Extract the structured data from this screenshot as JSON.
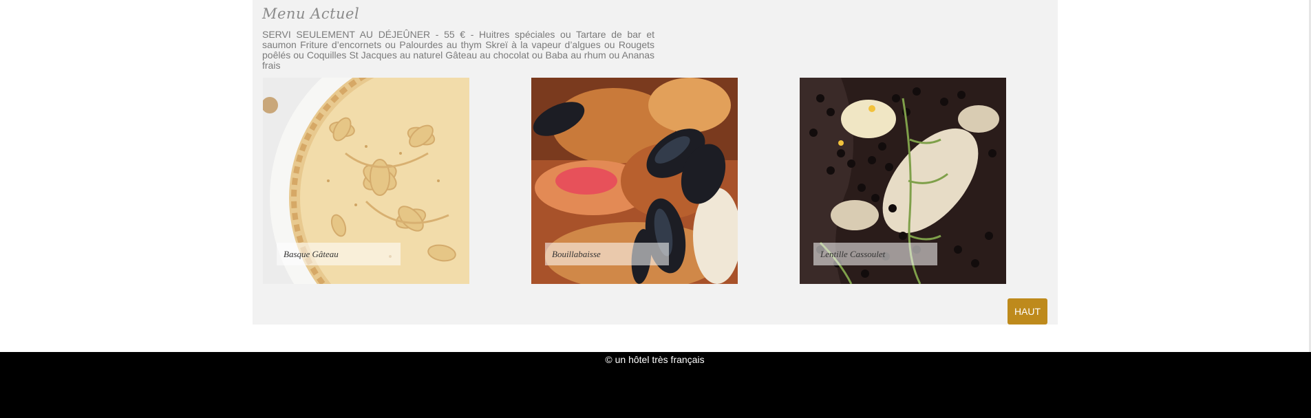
{
  "menu": {
    "title": "Menu Actuel",
    "description": "SERVI SEULEMENT AU DÉJEÛNER - 55 € - Huitres spéciales ou Tartare de bar et saumon Friture d’encornets ou Palourdes au thym Skreï à la vapeur d’algues ou Rougets poêlés ou Coquilles St Jacques au naturel Gâteau au chocolat ou Baba au rhum ou Ananas frais"
  },
  "dishes": [
    {
      "label": "Basque Gâteau"
    },
    {
      "label": "Bouillabaisse"
    },
    {
      "label": "Lentille Cassoulet"
    }
  ],
  "haut_button": {
    "label": "HAUT",
    "color": "#be8a1c"
  },
  "footer": {
    "copyright": "© un hôtel très français",
    "background": "#000000"
  }
}
